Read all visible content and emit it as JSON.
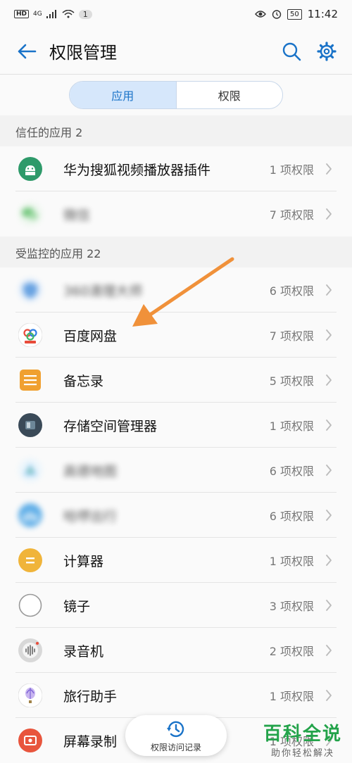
{
  "status_bar": {
    "network": "4G",
    "notification_count": "1",
    "battery": "50",
    "time": "11:42"
  },
  "app_bar": {
    "title": "权限管理"
  },
  "segment": {
    "tabs": [
      "应用",
      "权限"
    ],
    "active": 0
  },
  "trusted": {
    "header": "信任的应用 2",
    "items": [
      {
        "name": "华为搜狐视频播放器插件",
        "count": "1 项权限",
        "icon": "android-icon",
        "color": "#2e9a6a"
      },
      {
        "name": "微信",
        "count": "7 项权限",
        "icon": "wechat-icon",
        "color": "#3cb34a",
        "blurred": true
      }
    ]
  },
  "monitored": {
    "header": "受监控的应用 22",
    "items": [
      {
        "name": "360清理大师",
        "count": "6 项权限",
        "icon": "shield-icon",
        "color": "#2d7fd8",
        "blurred": true
      },
      {
        "name": "百度网盘",
        "count": "7 项权限",
        "icon": "cloud-icon",
        "color": "#2f7fe6"
      },
      {
        "name": "备忘录",
        "count": "5 项权限",
        "icon": "notes-icon",
        "color": "#f0a030"
      },
      {
        "name": "存储空间管理器",
        "count": "1 项权限",
        "icon": "storage-icon",
        "color": "#3a4a58"
      },
      {
        "name": "高德地图",
        "count": "6 项权限",
        "icon": "map-icon",
        "color": "#4ca6e8",
        "blurred": true
      },
      {
        "name": "哈啰出行",
        "count": "6 项权限",
        "icon": "bike-icon",
        "color": "#1f8fe0",
        "blurred": true
      },
      {
        "name": "计算器",
        "count": "1 项权限",
        "icon": "calculator-icon",
        "color": "#f0b43a"
      },
      {
        "name": "镜子",
        "count": "3 项权限",
        "icon": "mirror-icon",
        "color": "#ffffff"
      },
      {
        "name": "录音机",
        "count": "2 项权限",
        "icon": "recorder-icon",
        "color": "#d8d8d8"
      },
      {
        "name": "旅行助手",
        "count": "1 项权限",
        "icon": "balloon-icon",
        "color": "#ffffff"
      },
      {
        "name": "屏幕录制",
        "count": "1 项权限",
        "icon": "screen-record-icon",
        "color": "#e8553d"
      }
    ]
  },
  "fab": {
    "label": "权限访问记录"
  },
  "watermark": {
    "main": "百科全说",
    "sub": "助你轻松解决"
  },
  "colors": {
    "accent": "#1a73c8",
    "arrow": "#f0913a"
  }
}
